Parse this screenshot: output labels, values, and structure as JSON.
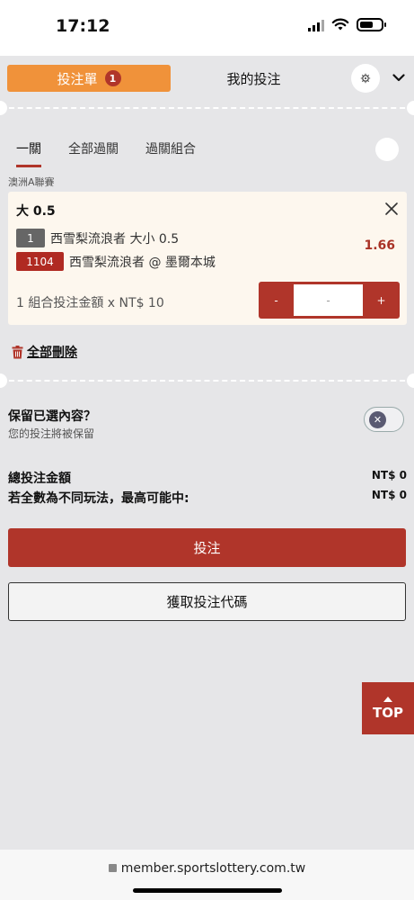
{
  "status_bar": {
    "time": "17:12"
  },
  "header": {
    "tab_bet_label": "投注單",
    "tab_bet_badge": "1",
    "tab_my_label": "我的投注"
  },
  "subtabs": [
    "一關",
    "全部過關",
    "過關組合"
  ],
  "league": "澳洲A聯賽",
  "bet": {
    "selection": "大 0.5",
    "line1_num": "1",
    "line1_text": "西雪梨流浪者 大小 0.5",
    "line2_num": "1104",
    "line2_text": "西雪梨流浪者 @ 墨爾本城",
    "odds": "1.66",
    "combo_label": "1 組合投注金額 x NT$ 10",
    "stepper_minus": "-",
    "stepper_value": "-",
    "stepper_plus": "+"
  },
  "delete_all": "全部刪除",
  "keep": {
    "title": "保留已選內容？",
    "subtitle": "您的投注將被保留"
  },
  "summary": {
    "total_label": "總投注金額",
    "total_value": "NT$ 0",
    "max_label": "若全數為不同玩法，最高可能中:",
    "max_value": "NT$ 0"
  },
  "buttons": {
    "bet": "投注",
    "get_code": "獲取投注代碼",
    "top": "TOP"
  },
  "footer": {
    "url": "member.sportslottery.com.tw"
  },
  "colors": {
    "accent": "#b0352a",
    "orange": "#f0923a"
  }
}
